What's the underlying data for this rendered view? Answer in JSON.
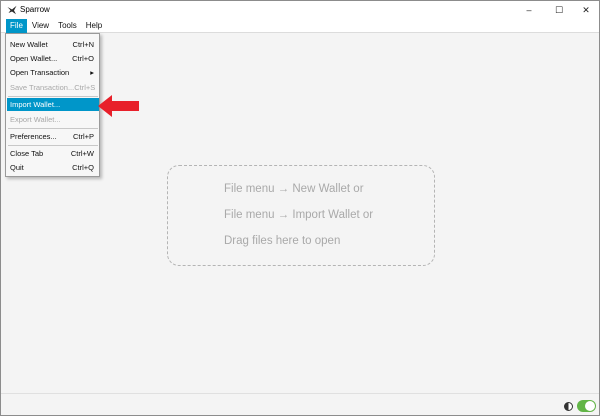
{
  "window": {
    "title": "Sparrow",
    "controls": {
      "minimize": "–",
      "maximize": "☐",
      "close": "✕"
    }
  },
  "menubar": {
    "items": [
      {
        "label": "File",
        "active": true
      },
      {
        "label": "View",
        "active": false
      },
      {
        "label": "Tools",
        "active": false
      },
      {
        "label": "Help",
        "active": false
      }
    ]
  },
  "file_menu": {
    "items": [
      {
        "label": "New Wallet",
        "shortcut": "Ctrl+N",
        "state": "enabled"
      },
      {
        "label": "Open Wallet...",
        "shortcut": "Ctrl+O",
        "state": "enabled"
      },
      {
        "label": "Open Transaction",
        "shortcut": "▸",
        "state": "enabled"
      },
      {
        "label": "Save Transaction...",
        "shortcut": "Ctrl+S",
        "state": "disabled"
      },
      {
        "label": "Import Wallet...",
        "shortcut": "",
        "state": "highlighted"
      },
      {
        "label": "Export Wallet...",
        "shortcut": "",
        "state": "disabled"
      },
      {
        "label": "Preferences...",
        "shortcut": "Ctrl+P",
        "state": "enabled"
      },
      {
        "label": "Close Tab",
        "shortcut": "Ctrl+W",
        "state": "enabled"
      },
      {
        "label": "Quit",
        "shortcut": "Ctrl+Q",
        "state": "enabled"
      }
    ]
  },
  "dropzone": {
    "lines": [
      "File menu → New Wallet or",
      "File menu → Import Wallet or",
      "Drag files here to open"
    ]
  },
  "colors": {
    "accent": "#0096c9",
    "annotation_arrow": "#e8202a",
    "toggle_on": "#62b547"
  }
}
